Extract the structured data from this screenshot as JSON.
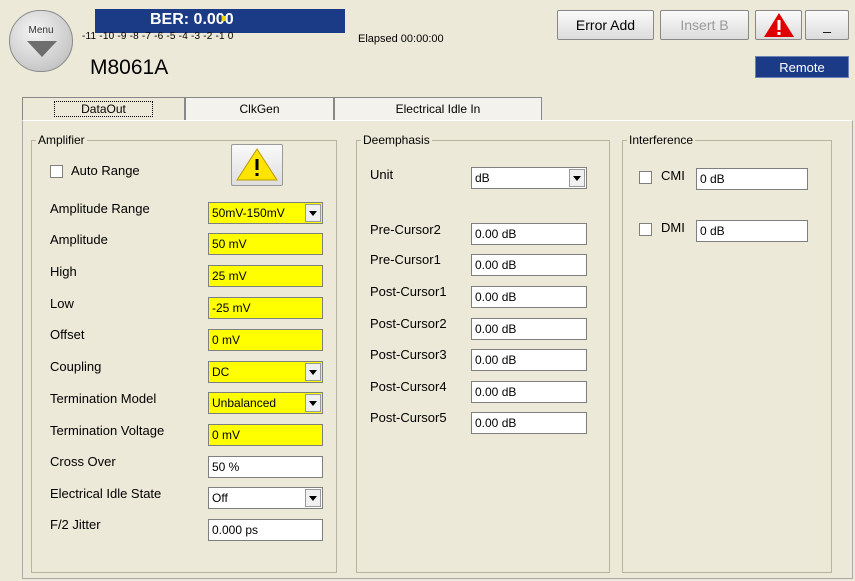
{
  "menu": {
    "label": "Menu"
  },
  "ber": {
    "text": "BER: 0.000",
    "scale": "-11 -10  -9   -8   -7   -6   -5   -4   -3   -2   -1   0",
    "elapsed": "Elapsed 00:00:00"
  },
  "model": "M8061A",
  "toolbar": {
    "error_add": "Error Add",
    "insert_b": "Insert B",
    "minimize": "_",
    "remote": "Remote"
  },
  "tabs": [
    "DataOut",
    "ClkGen",
    "Electrical Idle In"
  ],
  "amplifier": {
    "legend": "Amplifier",
    "auto_range": "Auto Range",
    "rows": [
      {
        "label": "Amplitude Range",
        "value": "50mV-150mV"
      },
      {
        "label": "Amplitude",
        "value": "50 mV"
      },
      {
        "label": "High",
        "value": "25 mV"
      },
      {
        "label": "Low",
        "value": "-25 mV"
      },
      {
        "label": "Offset",
        "value": "0 mV"
      },
      {
        "label": "Coupling",
        "value": "DC"
      },
      {
        "label": "Termination Model",
        "value": "Unbalanced"
      },
      {
        "label": "Termination Voltage",
        "value": "0 mV"
      },
      {
        "label": "Cross Over",
        "value": "50 %"
      },
      {
        "label": "Electrical Idle State",
        "value": "Off"
      },
      {
        "label": "F/2 Jitter",
        "value": "0.000 ps"
      }
    ]
  },
  "deemphasis": {
    "legend": "Deemphasis",
    "unit_label": "Unit",
    "unit_value": "dB",
    "rows": [
      {
        "label": "Pre-Cursor2",
        "value": "0.00 dB"
      },
      {
        "label": "Pre-Cursor1",
        "value": "0.00 dB"
      },
      {
        "label": "Post-Cursor1",
        "value": "0.00 dB"
      },
      {
        "label": "Post-Cursor2",
        "value": "0.00 dB"
      },
      {
        "label": "Post-Cursor3",
        "value": "0.00 dB"
      },
      {
        "label": "Post-Cursor4",
        "value": "0.00 dB"
      },
      {
        "label": "Post-Cursor5",
        "value": "0.00 dB"
      }
    ]
  },
  "interference": {
    "legend": "Interference",
    "cmi_label": "CMI",
    "cmi_value": "0 dB",
    "dmi_label": "DMI",
    "dmi_value": "0 dB"
  },
  "colors": {
    "accent_blue": "#1c3b86",
    "highlight_yellow": "#ffff00",
    "warn_red": "#e00000"
  }
}
